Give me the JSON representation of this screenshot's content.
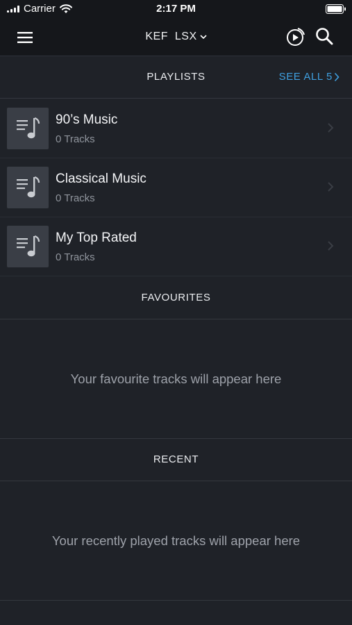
{
  "status_bar": {
    "carrier": "Carrier",
    "time": "2:17 PM"
  },
  "nav": {
    "device_name": "KEF  LSX",
    "icons": {
      "menu": "hamburger-menu-icon",
      "play": "play-circle-icon",
      "search": "search-icon",
      "dropdown": "chevron-down-icon"
    }
  },
  "playlists": {
    "header": "PLAYLISTS",
    "see_all": "SEE ALL 5",
    "items": [
      {
        "title": "90’s Music",
        "subtitle": "0 Tracks"
      },
      {
        "title": "Classical Music",
        "subtitle": "0 Tracks"
      },
      {
        "title": "My Top Rated",
        "subtitle": "0 Tracks"
      }
    ]
  },
  "favourites": {
    "header": "FAVOURITES",
    "empty_text": "Your favourite tracks will appear here"
  },
  "recent": {
    "header": "RECENT",
    "empty_text": "Your recently played tracks will appear here"
  },
  "colors": {
    "background": "#1f2228",
    "bar": "#15171b",
    "accent": "#3fa0e0",
    "thumb": "#3a3e46"
  }
}
